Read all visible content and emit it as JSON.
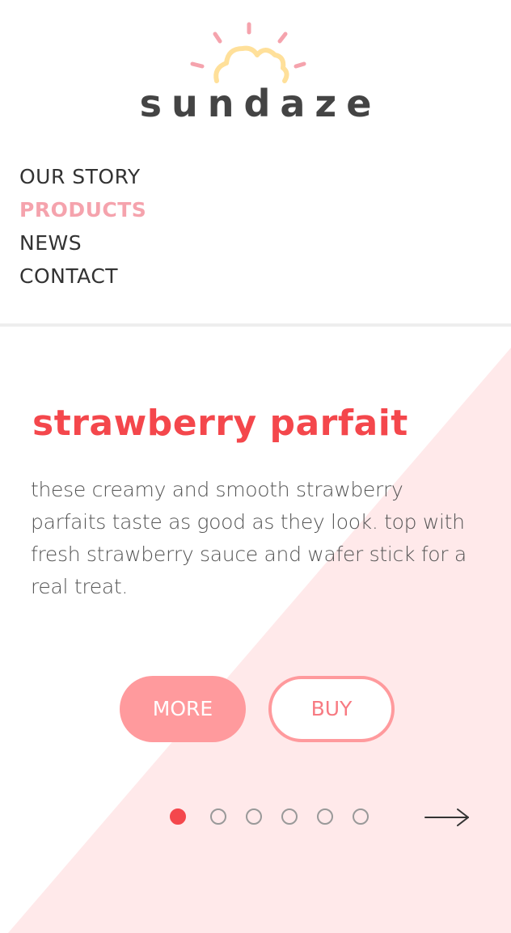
{
  "brand": {
    "name": "sundaze",
    "logo_icon": "sun-cloud-icon",
    "colors": {
      "sun_rays": "#f5a3ad",
      "cloud": "#ffe09a",
      "wordmark": "#444444"
    }
  },
  "nav": {
    "items": [
      {
        "label": "OUR STORY",
        "active": false
      },
      {
        "label": "PRODUCTS",
        "active": true
      },
      {
        "label": "NEWS",
        "active": false
      },
      {
        "label": "CONTACT",
        "active": false
      }
    ],
    "active_color": "#f5a3ad"
  },
  "slide": {
    "title": "strawberry parfait",
    "description": "these creamy and smooth strawberry parfaits taste as good as they look. top with fresh strawberry sauce and wafer stick for a real treat.",
    "buttons": {
      "more_label": "MORE",
      "buy_label": "BUY"
    },
    "pagination": {
      "count": 6,
      "current": 1
    },
    "next_icon": "arrow-right-icon",
    "colors": {
      "title": "#f4474c",
      "accent_bg": "#ffe9ea",
      "button": "#ff9a9d"
    }
  }
}
